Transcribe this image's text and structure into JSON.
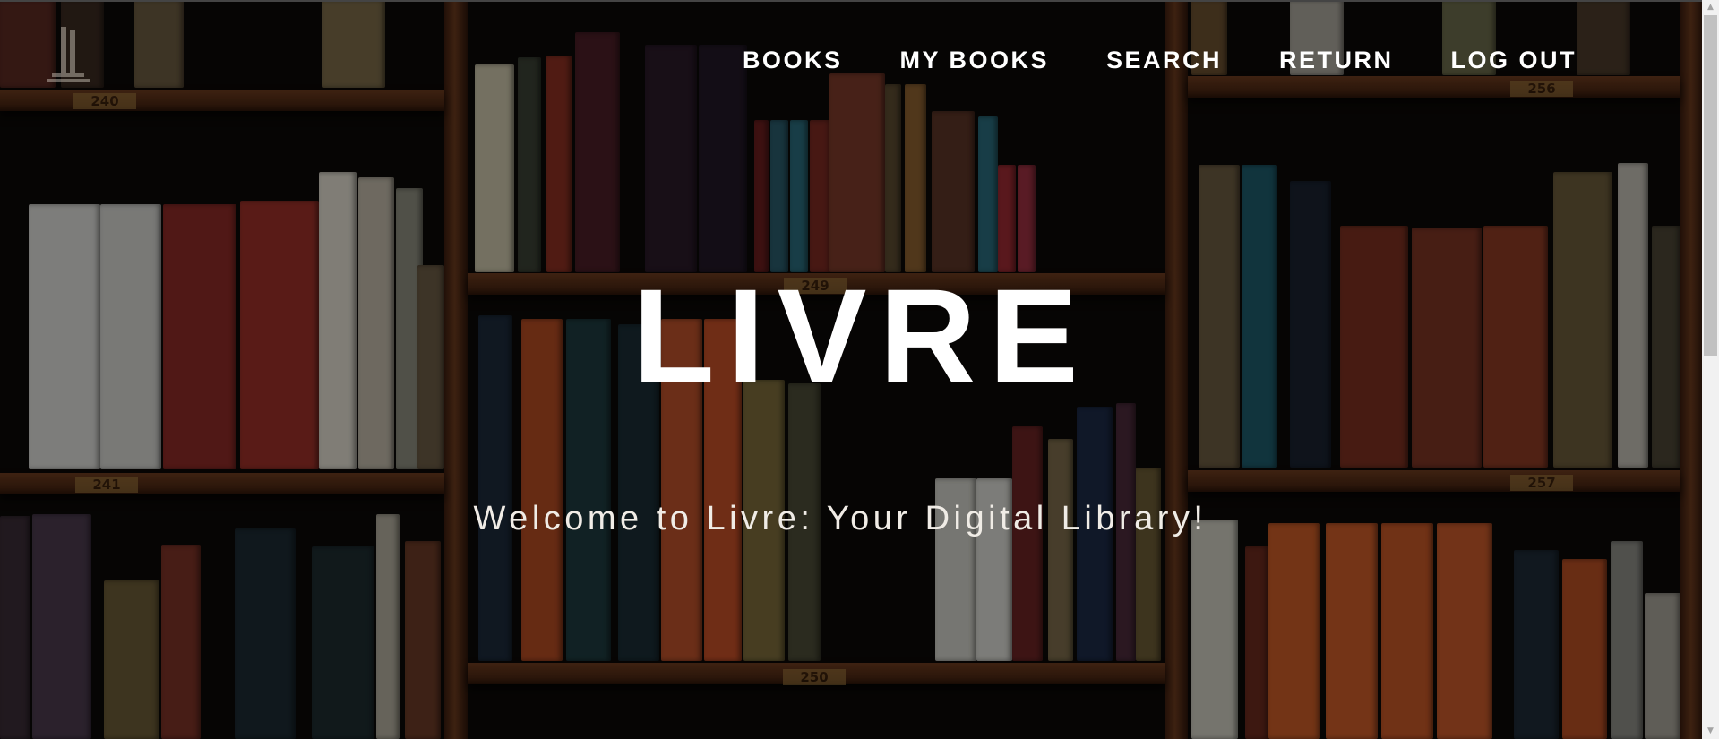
{
  "nav": {
    "items": [
      {
        "label": "BOOKS"
      },
      {
        "label": "MY BOOKS"
      },
      {
        "label": "SEARCH"
      },
      {
        "label": "RETURN"
      },
      {
        "label": "LOG OUT"
      }
    ]
  },
  "hero": {
    "title": "LIVRE",
    "subtitle": "Welcome to Livre: Your Digital Library!"
  },
  "shelf_labels": [
    "240",
    "241",
    "249",
    "250",
    "256",
    "257"
  ],
  "scrollbar": {
    "up_arrow": "▲",
    "down_arrow": "▼"
  },
  "icons": {
    "logo": "book-logo-icon"
  }
}
